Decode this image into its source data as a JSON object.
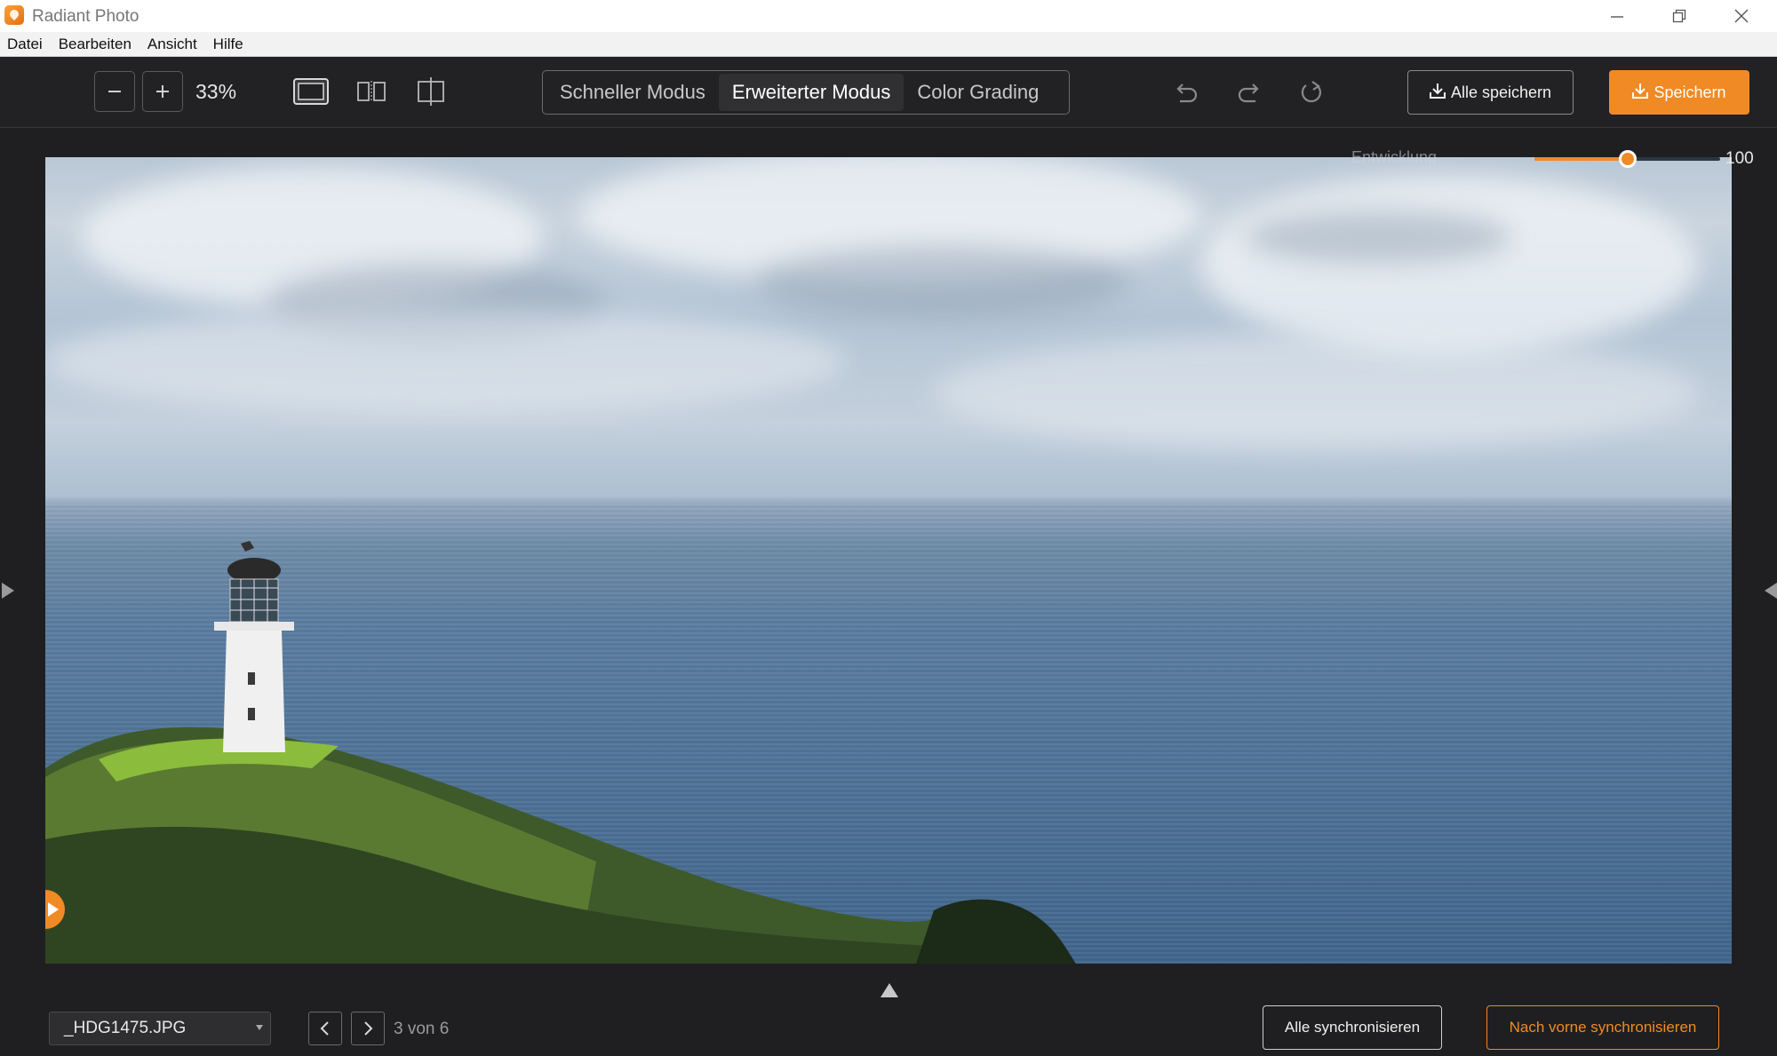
{
  "window": {
    "title": "Radiant Photo",
    "controls": {
      "minimize_icon": "minimize-icon",
      "restore_icon": "restore-icon",
      "close_icon": "close-icon"
    }
  },
  "menu": [
    "Datei",
    "Bearbeiten",
    "Ansicht",
    "Hilfe"
  ],
  "toolbar": {
    "zoom_out_icon": "minus-icon",
    "zoom_in_icon": "plus-icon",
    "zoom_value": "33%",
    "view_icons": [
      "single-view-icon",
      "split-view-icon",
      "crop-compare-icon"
    ],
    "modes": [
      {
        "label": "Schneller Modus",
        "active": false
      },
      {
        "label": "Erweiterter Modus",
        "active": true
      },
      {
        "label": "Color Grading",
        "active": false
      }
    ],
    "history_icons": [
      "undo-icon",
      "redo-icon",
      "reset-icon"
    ],
    "save_all_label": "Alle speichern",
    "save_label": "Speichern"
  },
  "development": {
    "label": "Entwicklung",
    "value": "100",
    "level_percent": 50
  },
  "footer": {
    "file_name": "_HDG1475.JPG",
    "page_text": "3 von 6",
    "sync_all_label": "Alle synchronisieren",
    "sync_forward_label": "Nach vorne synchronisieren"
  },
  "colors": {
    "accent": "#f08a24",
    "background": "#1f1f21",
    "toolbar": "#222224"
  }
}
